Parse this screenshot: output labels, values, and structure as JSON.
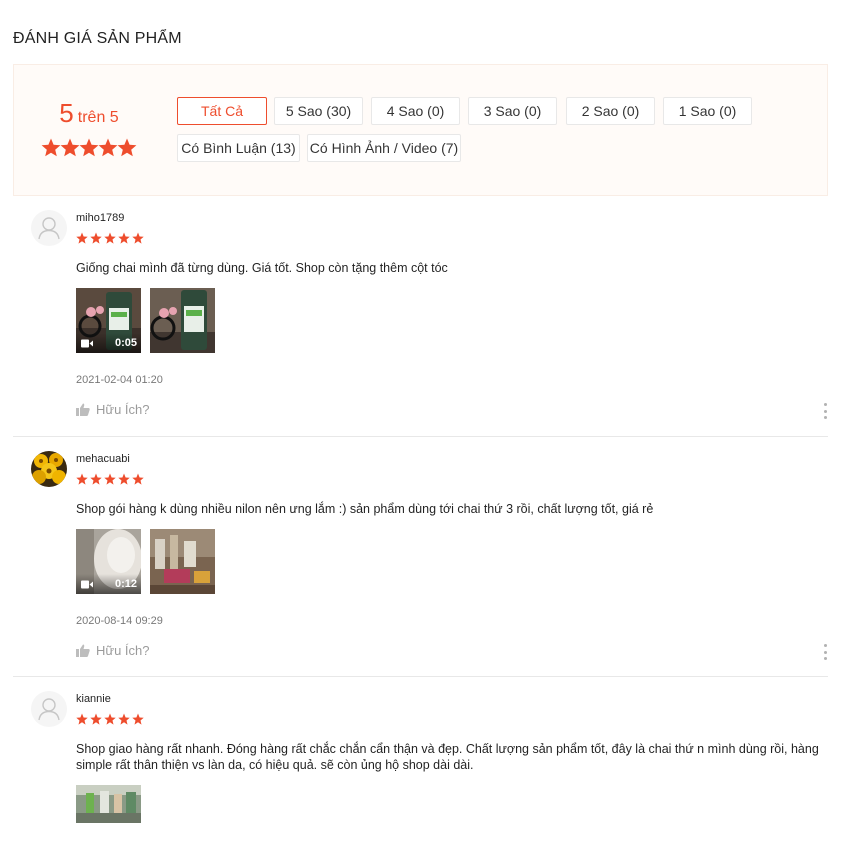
{
  "section_title": "ĐÁNH GIÁ SẢN PHẨM",
  "overview": {
    "score": "5",
    "out_of": "trên 5",
    "rating_stars": 5,
    "star_color": "#ee4d2d"
  },
  "filters": [
    {
      "label": "Tất Cả",
      "active": true
    },
    {
      "label": "5 Sao (30)",
      "active": false
    },
    {
      "label": "4 Sao (0)",
      "active": false
    },
    {
      "label": "3 Sao (0)",
      "active": false
    },
    {
      "label": "2 Sao (0)",
      "active": false
    },
    {
      "label": "1 Sao (0)",
      "active": false
    },
    {
      "label": "Có Bình Luận (13)",
      "active": false
    },
    {
      "label": "Có Hình Ảnh / Video (7)",
      "active": false
    }
  ],
  "reviews": [
    {
      "author": "miho1789",
      "rating": 5,
      "avatar": "default-avatar-icon",
      "comment": "Giống chai mình đã từng dùng. Giá tốt. Shop còn tặng thêm cột tóc",
      "media": [
        {
          "type": "video",
          "duration": "0:05"
        },
        {
          "type": "image"
        }
      ],
      "date": "2021-02-04 01:20",
      "helpful_label": "Hữu Ích?"
    },
    {
      "author": "mehacuabi",
      "rating": 5,
      "avatar": "flower-avatar",
      "comment": "Shop gói hàng k dùng nhiều nilon nên ưng lắm :) sản phẩm dùng tới chai thứ 3 rồi, chất lượng tốt, giá rẻ",
      "media": [
        {
          "type": "video",
          "duration": "0:12"
        },
        {
          "type": "image"
        }
      ],
      "date": "2020-08-14 09:29",
      "helpful_label": "Hữu Ích?"
    },
    {
      "author": "kiannie",
      "rating": 5,
      "avatar": "default-avatar-icon",
      "comment": "Shop giao hàng rất nhanh. Đóng hàng rất chắc chắn cẩn thận và đẹp. Chất lượng sản phẩm tốt, đây là chai thứ n mình dùng rồi, hàng simple rất thân thiện vs làn da, có hiệu quả. sẽ còn ủng hộ shop dài dài.",
      "media": [
        {
          "type": "image"
        }
      ]
    }
  ]
}
